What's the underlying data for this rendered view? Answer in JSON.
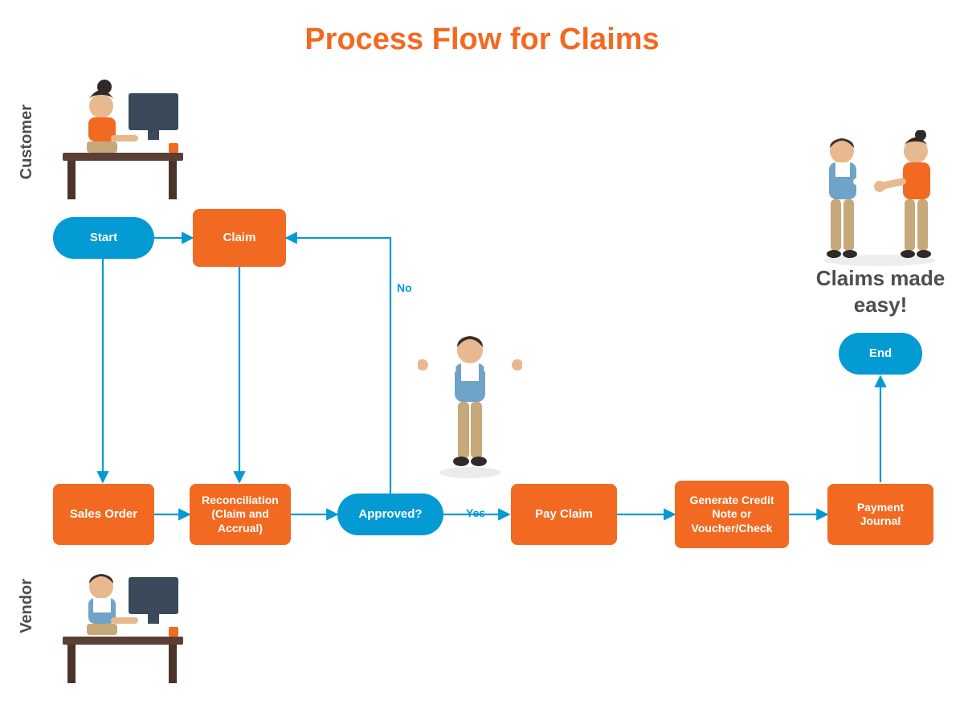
{
  "title": "Process Flow for Claims",
  "swimlanes": {
    "customer": "Customer",
    "vendor": "Vendor"
  },
  "nodes": {
    "start": "Start",
    "claim": "Claim",
    "sales_order": "Sales Order",
    "reconciliation": "Reconciliation (Claim and Accrual)",
    "approved": "Approved?",
    "pay_claim": "Pay Claim",
    "credit_note": "Generate Credit Note or Voucher/Check",
    "payment_journal": "Payment Journal",
    "end": "End"
  },
  "edges": {
    "yes": "Yes",
    "no": "No"
  },
  "tagline": "Claims made easy!",
  "colors": {
    "accent_orange": "#f26a21",
    "accent_blue": "#049ad3",
    "text_gray": "#4d4d4d"
  },
  "illustrations": {
    "customer_desk": "woman-at-desk-computer",
    "vendor_desk": "man-at-desk-computer",
    "shrug_person": "man-shrugging",
    "handshake_pair": "two-people-handshake"
  }
}
